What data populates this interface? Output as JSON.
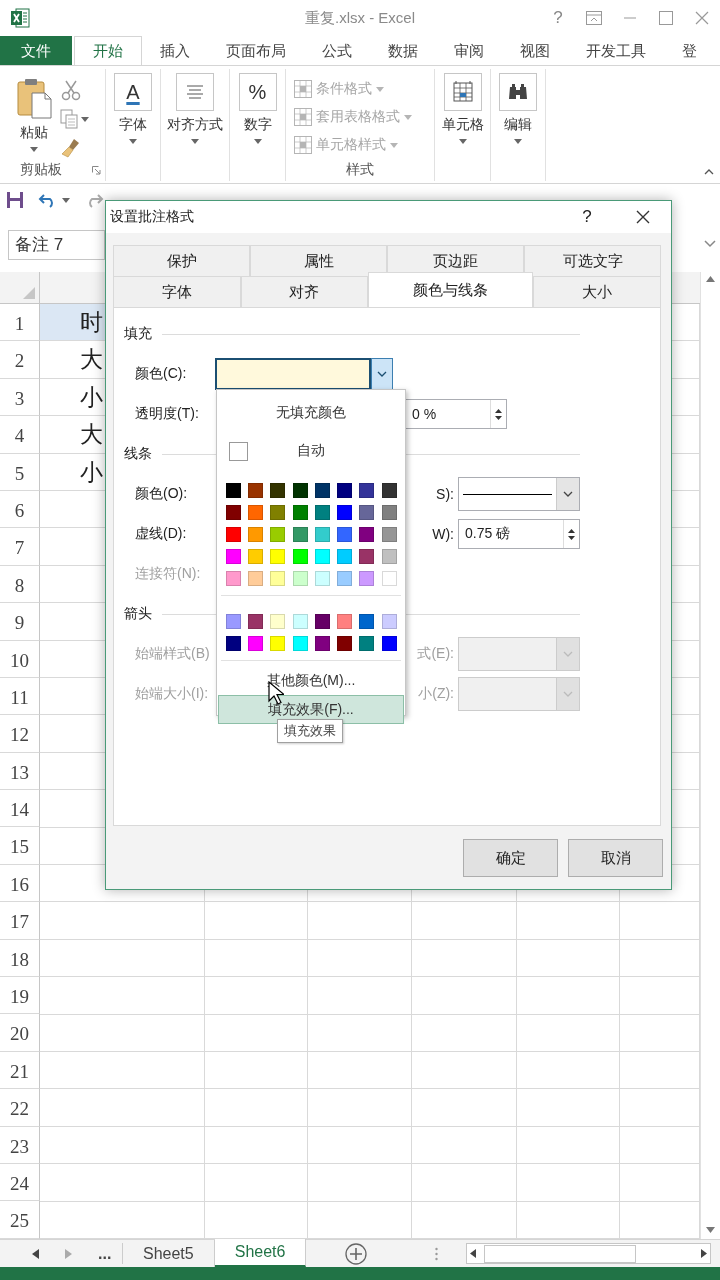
{
  "window": {
    "title": "重复.xlsx - Excel",
    "help": "?"
  },
  "ribbon_tabs": [
    {
      "label": "文件",
      "kind": "file",
      "selected": false
    },
    {
      "label": "开始",
      "kind": "tab",
      "selected": true
    },
    {
      "label": "插入",
      "kind": "tab",
      "selected": false
    },
    {
      "label": "页面布局",
      "kind": "tab",
      "selected": false
    },
    {
      "label": "公式",
      "kind": "tab",
      "selected": false
    },
    {
      "label": "数据",
      "kind": "tab",
      "selected": false
    },
    {
      "label": "审阅",
      "kind": "tab",
      "selected": false
    },
    {
      "label": "视图",
      "kind": "tab",
      "selected": false
    },
    {
      "label": "开发工具",
      "kind": "tab",
      "selected": false
    },
    {
      "label": "登",
      "kind": "tab",
      "selected": false
    }
  ],
  "ribbon_groups": [
    {
      "kind": "clipboard",
      "button": "粘贴",
      "label": "剪贴板"
    },
    {
      "kind": "glyph",
      "glyph": "A",
      "underlined": true,
      "button": "字体"
    },
    {
      "kind": "lines",
      "button": "对齐方式"
    },
    {
      "kind": "glyph",
      "glyph": "%",
      "underlined": false,
      "button": "数字"
    },
    {
      "kind": "styles",
      "items": [
        {
          "label": "条件格式",
          "disabled": true
        },
        {
          "label": "套用表格格式",
          "disabled": true
        },
        {
          "label": "单元格样式",
          "disabled": true
        }
      ],
      "label": "样式"
    },
    {
      "kind": "cells",
      "button": "单元格"
    },
    {
      "kind": "find",
      "button": "编辑"
    }
  ],
  "name_box": {
    "value": "备注 7"
  },
  "sheet": {
    "row_numbers": [
      "1",
      "2",
      "3",
      "4",
      "5",
      "6",
      "7",
      "8",
      "9",
      "10",
      "11",
      "12",
      "13",
      "14",
      "15",
      "16",
      "17",
      "18",
      "19",
      "20",
      "21",
      "22",
      "23",
      "24",
      "25"
    ],
    "column_a": [
      {
        "text": "时",
        "selected": true
      },
      {
        "text": "大",
        "selected": false
      },
      {
        "text": "小",
        "selected": false
      },
      {
        "text": "大",
        "selected": false
      },
      {
        "text": "小",
        "selected": false
      }
    ]
  },
  "sheet_tabs": {
    "more": "...",
    "tabs": [
      {
        "label": "Sheet5",
        "selected": false
      },
      {
        "label": "Sheet6",
        "selected": true
      }
    ]
  },
  "dialog": {
    "title": "设置批注格式",
    "help": "?",
    "tab_rows": [
      [
        {
          "label": "保护",
          "selected": false
        },
        {
          "label": "属性",
          "selected": false
        },
        {
          "label": "页边距",
          "selected": false
        },
        {
          "label": "可选文字",
          "selected": false
        }
      ],
      [
        {
          "label": "字体",
          "selected": false
        },
        {
          "label": "对齐",
          "selected": false
        },
        {
          "label": "颜色与线条",
          "selected": true
        },
        {
          "label": "大小",
          "selected": false
        }
      ]
    ],
    "rows": [
      {
        "kind": "section",
        "label": "填充"
      },
      {
        "kind": "field",
        "label": "颜色(C):",
        "disabled": false,
        "control": {
          "kind": "color",
          "color": "#fff9dc",
          "expanded": true
        }
      },
      {
        "kind": "field",
        "label": "透明度(T):",
        "disabled": false,
        "side_control": {
          "kind": "spin",
          "value": "0 %",
          "disabled": false
        }
      },
      {
        "kind": "section",
        "label": "线条"
      },
      {
        "kind": "field",
        "label": "颜色(O):",
        "disabled": false,
        "side_label": "S):",
        "side_control": {
          "kind": "line",
          "disabled": false
        }
      },
      {
        "kind": "field",
        "label": "虚线(D):",
        "disabled": false,
        "side_label": "W):",
        "side_control": {
          "kind": "spin",
          "value": "0.75 磅",
          "disabled": false
        }
      },
      {
        "kind": "field",
        "label": "连接符(N):",
        "disabled": true
      },
      {
        "kind": "section",
        "label": "箭头"
      },
      {
        "kind": "field",
        "label": "始端样式(B)",
        "disabled": true,
        "side_label": "式(E):",
        "side_control": {
          "kind": "combo",
          "disabled": true
        }
      },
      {
        "kind": "field",
        "label": "始端大小(I):",
        "disabled": true,
        "side_label": "小(Z):",
        "side_control": {
          "kind": "combo",
          "disabled": true
        }
      }
    ],
    "buttons": [
      "确定",
      "取消"
    ],
    "popup": {
      "items": [
        {
          "kind": "option",
          "label": "无填充颜色",
          "selected": false
        },
        {
          "kind": "auto",
          "label": "自动",
          "selected": false
        },
        {
          "kind": "swatches",
          "colors": [
            {
              "color": "#000000"
            },
            {
              "color": "#993300"
            },
            {
              "color": "#333300"
            },
            {
              "color": "#003300"
            },
            {
              "color": "#003366"
            },
            {
              "color": "#000080"
            },
            {
              "color": "#333399"
            },
            {
              "color": "#333333"
            },
            {
              "color": "#800000"
            },
            {
              "color": "#ff6600"
            },
            {
              "color": "#808000"
            },
            {
              "color": "#008000"
            },
            {
              "color": "#008080"
            },
            {
              "color": "#0000ff"
            },
            {
              "color": "#666699"
            },
            {
              "color": "#808080"
            },
            {
              "color": "#ff0000"
            },
            {
              "color": "#ff9900"
            },
            {
              "color": "#99cc00"
            },
            {
              "color": "#339966"
            },
            {
              "color": "#33cccc"
            },
            {
              "color": "#3366ff"
            },
            {
              "color": "#800080"
            },
            {
              "color": "#969696"
            },
            {
              "color": "#ff00ff"
            },
            {
              "color": "#ffcc00"
            },
            {
              "color": "#ffff00"
            },
            {
              "color": "#00ff00"
            },
            {
              "color": "#00ffff"
            },
            {
              "color": "#00ccff"
            },
            {
              "color": "#993366"
            },
            {
              "color": "#c0c0c0"
            },
            {
              "color": "#ff99cc"
            },
            {
              "color": "#ffcc99"
            },
            {
              "color": "#ffff99"
            },
            {
              "color": "#ccffcc"
            },
            {
              "color": "#ccffff"
            },
            {
              "color": "#99ccff"
            },
            {
              "color": "#cc99ff"
            },
            {
              "color": "#ffffff"
            }
          ]
        },
        {
          "kind": "swatches",
          "colors": [
            {
              "color": "#9999ff"
            },
            {
              "color": "#993366"
            },
            {
              "color": "#ffffcc"
            },
            {
              "color": "#ccffff"
            },
            {
              "color": "#660066"
            },
            {
              "color": "#ff8080"
            },
            {
              "color": "#0066cc"
            },
            {
              "color": "#ccccff"
            },
            {
              "color": "#000080"
            },
            {
              "color": "#ff00ff"
            },
            {
              "color": "#ffff00"
            },
            {
              "color": "#00ffff"
            },
            {
              "color": "#800080"
            },
            {
              "color": "#800000"
            },
            {
              "color": "#008080"
            },
            {
              "color": "#0000ff"
            }
          ]
        },
        {
          "kind": "option",
          "label": "其他颜色(M)...",
          "selected": false
        },
        {
          "kind": "option",
          "label": "填充效果(F)...",
          "selected": true
        }
      ],
      "tooltip": "填充效果"
    }
  }
}
